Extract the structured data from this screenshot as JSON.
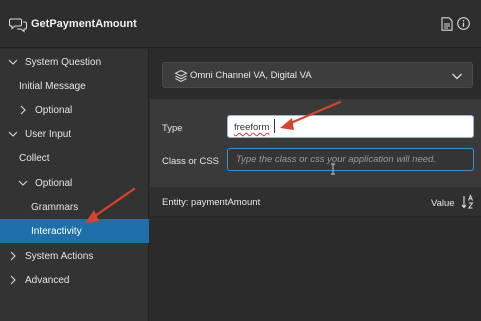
{
  "header": {
    "title": "GetPaymentAmount",
    "doc_icon": "document-icon",
    "info_icon": "info-icon",
    "title_icon": "chat-bubbles-icon"
  },
  "sidebar": {
    "items": [
      {
        "label": "System Question",
        "chevron": "down"
      },
      {
        "label": "Initial Message",
        "chevron": "none"
      },
      {
        "label": "Optional",
        "chevron": "right"
      },
      {
        "label": "User Input",
        "chevron": "down"
      },
      {
        "label": "Collect",
        "chevron": "none"
      },
      {
        "label": "Optional",
        "chevron": "down"
      },
      {
        "label": "Grammars",
        "chevron": "none"
      },
      {
        "label": "Interactivity",
        "chevron": "none",
        "active": true
      },
      {
        "label": "System Actions",
        "chevron": "right"
      },
      {
        "label": "Advanced",
        "chevron": "right"
      }
    ]
  },
  "main": {
    "channel_dropdown": {
      "label": "Omni Channel VA, Digital VA"
    },
    "type_field": {
      "label": "Type",
      "value": "freeform"
    },
    "class_field": {
      "label": "Class or CSS",
      "placeholder": "Type the class or css your application will need."
    },
    "entity": {
      "label": "Entity: paymentAmount",
      "value_header": "Value"
    }
  },
  "colors": {
    "accent": "#1f6fa8",
    "arrow": "#d4442e",
    "focus_border": "#3a8fd0"
  }
}
